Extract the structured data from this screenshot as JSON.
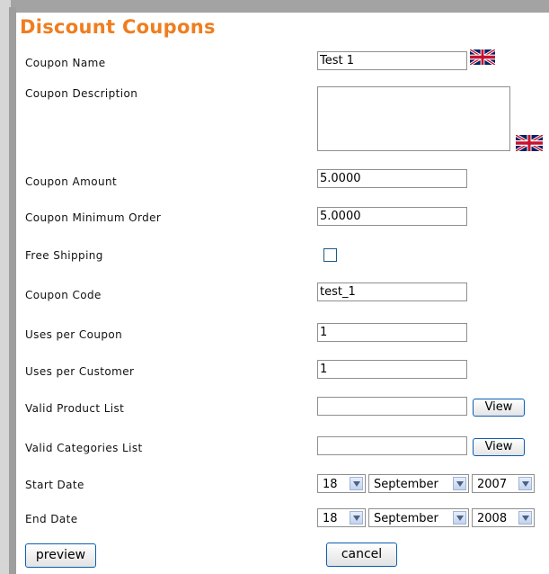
{
  "page": {
    "title": "Discount Coupons"
  },
  "form": {
    "coupon_name": {
      "label": "Coupon Name",
      "value": "Test 1"
    },
    "coupon_description": {
      "label": "Coupon Description",
      "value": ""
    },
    "coupon_amount": {
      "label": "Coupon Amount",
      "value": "5.0000"
    },
    "coupon_minimum_order": {
      "label": "Coupon Minimum Order",
      "value": "5.0000"
    },
    "free_shipping": {
      "label": "Free Shipping",
      "checked": false
    },
    "coupon_code": {
      "label": "Coupon Code",
      "value": "test_1"
    },
    "uses_per_coupon": {
      "label": "Uses per Coupon",
      "value": "1"
    },
    "uses_per_customer": {
      "label": "Uses per Customer",
      "value": "1"
    },
    "valid_product_list": {
      "label": "Valid Product List",
      "value": "",
      "button": "View"
    },
    "valid_categories_list": {
      "label": "Valid Categories List",
      "value": "",
      "button": "View"
    },
    "start_date": {
      "label": "Start Date",
      "day": "18",
      "month": "September",
      "year": "2007"
    },
    "end_date": {
      "label": "End Date",
      "day": "18",
      "month": "September",
      "year": "2008"
    }
  },
  "buttons": {
    "preview": "preview",
    "cancel": "cancel"
  },
  "icons": {
    "language_flag": "uk-flag-icon",
    "dropdown_arrow": "chevron-down-icon"
  },
  "colors": {
    "title": "#f07d1e",
    "button_border": "#0a5fb3"
  }
}
